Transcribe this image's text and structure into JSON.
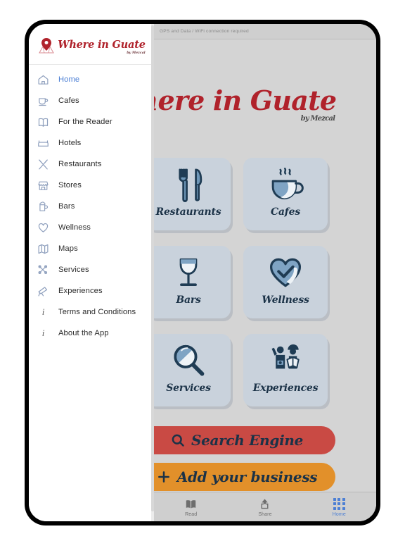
{
  "app": {
    "name": "Where in Guate",
    "byline": "by Mezcal",
    "status_note": "GPS and Data / WiFi connection required"
  },
  "sidebar": {
    "logo_text": "Where in Guate",
    "logo_sub": "by Mezcal",
    "items": [
      {
        "label": "Home",
        "icon": "house-icon",
        "active": true
      },
      {
        "label": "Cafes",
        "icon": "coffee-cup-icon",
        "active": false
      },
      {
        "label": "For the Reader",
        "icon": "open-book-icon",
        "active": false
      },
      {
        "label": "Hotels",
        "icon": "bed-icon",
        "active": false
      },
      {
        "label": "Restaurants",
        "icon": "fork-knife-icon",
        "active": false
      },
      {
        "label": "Stores",
        "icon": "storefront-icon",
        "active": false
      },
      {
        "label": "Bars",
        "icon": "beer-mug-icon",
        "active": false
      },
      {
        "label": "Wellness",
        "icon": "heart-icon",
        "active": false
      },
      {
        "label": "Maps",
        "icon": "map-icon",
        "active": false
      },
      {
        "label": "Services",
        "icon": "tools-icon",
        "active": false
      },
      {
        "label": "Experiences",
        "icon": "telescope-icon",
        "active": false
      },
      {
        "label": "Terms and Conditions",
        "icon": "info-icon",
        "active": false
      },
      {
        "label": "About the App",
        "icon": "info-icon",
        "active": false
      }
    ]
  },
  "main": {
    "logo_text": "Where in Guate",
    "logo_sub": "by Mezcal",
    "tiles": [
      {
        "label": "Restaurants",
        "icon": "fork-knife-icon"
      },
      {
        "label": "Cafes",
        "icon": "coffee-cup-icon"
      },
      {
        "label": "Bars",
        "icon": "wine-glass-icon"
      },
      {
        "label": "Wellness",
        "icon": "heart-check-icon"
      },
      {
        "label": "Services",
        "icon": "magnifier-icon"
      },
      {
        "label": "Experiences",
        "icon": "tourists-icon"
      }
    ],
    "actions": [
      {
        "label": "Search Engine",
        "icon": "magnifier-icon",
        "color": "#c94a44"
      },
      {
        "label": "Add your business",
        "icon": "plus-icon",
        "color": "#e2902a"
      }
    ]
  },
  "bottom_nav": {
    "items": [
      {
        "label": "Read",
        "icon": "open-book-icon",
        "active": false
      },
      {
        "label": "Share",
        "icon": "share-upload-icon",
        "active": false
      },
      {
        "label": "Home",
        "icon": "grid-icon",
        "active": true
      }
    ]
  },
  "colors": {
    "brand_red": "#b0222b",
    "accent_blue": "#4c7fd4",
    "tile_bg": "#c9d2dc",
    "icon_navy": "#1f3c54",
    "button_red": "#c94a44",
    "button_orange": "#e2902a",
    "content_bg": "#d4d4d4"
  }
}
